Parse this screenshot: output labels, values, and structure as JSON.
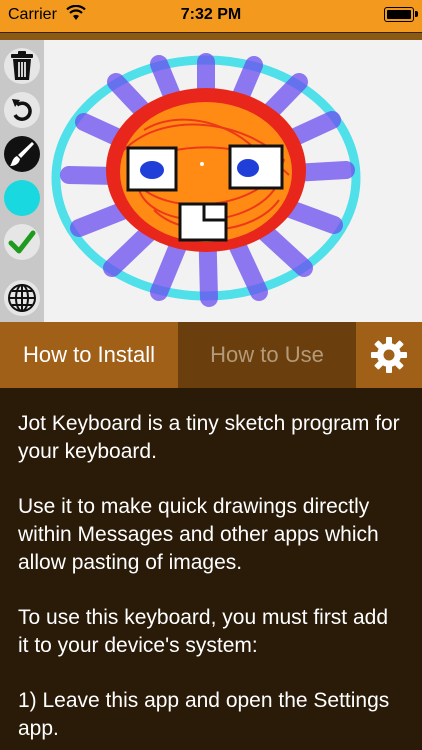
{
  "status_bar": {
    "carrier": "Carrier",
    "time": "7:32 PM",
    "wifi_icon": "wifi-icon",
    "battery_icon": "battery-icon"
  },
  "toolbar": {
    "tools": [
      "trash-icon",
      "undo-icon",
      "brush-icon",
      "color-swatch",
      "checkmark-icon",
      "globe-icon"
    ],
    "colors": {
      "swatch": "#19d8e0",
      "check": "#1e9a1e"
    }
  },
  "tabs": {
    "install_label": "How to Install",
    "use_label": "How to Use",
    "settings_icon": "gear-icon"
  },
  "content": {
    "p1": "Jot Keyboard is a tiny sketch program for your keyboard.",
    "p2": "Use it to make quick drawings directly within Messages and other apps which allow pasting of images.",
    "p3": "To use this keyboard, you must first add it to your device's system:",
    "p4": "1) Leave this app and open the Settings app."
  },
  "colors": {
    "accent": "#f39a1e",
    "tab_active": "#a06018",
    "tab_inactive": "#6b3e0d",
    "background": "#2a1a08"
  }
}
